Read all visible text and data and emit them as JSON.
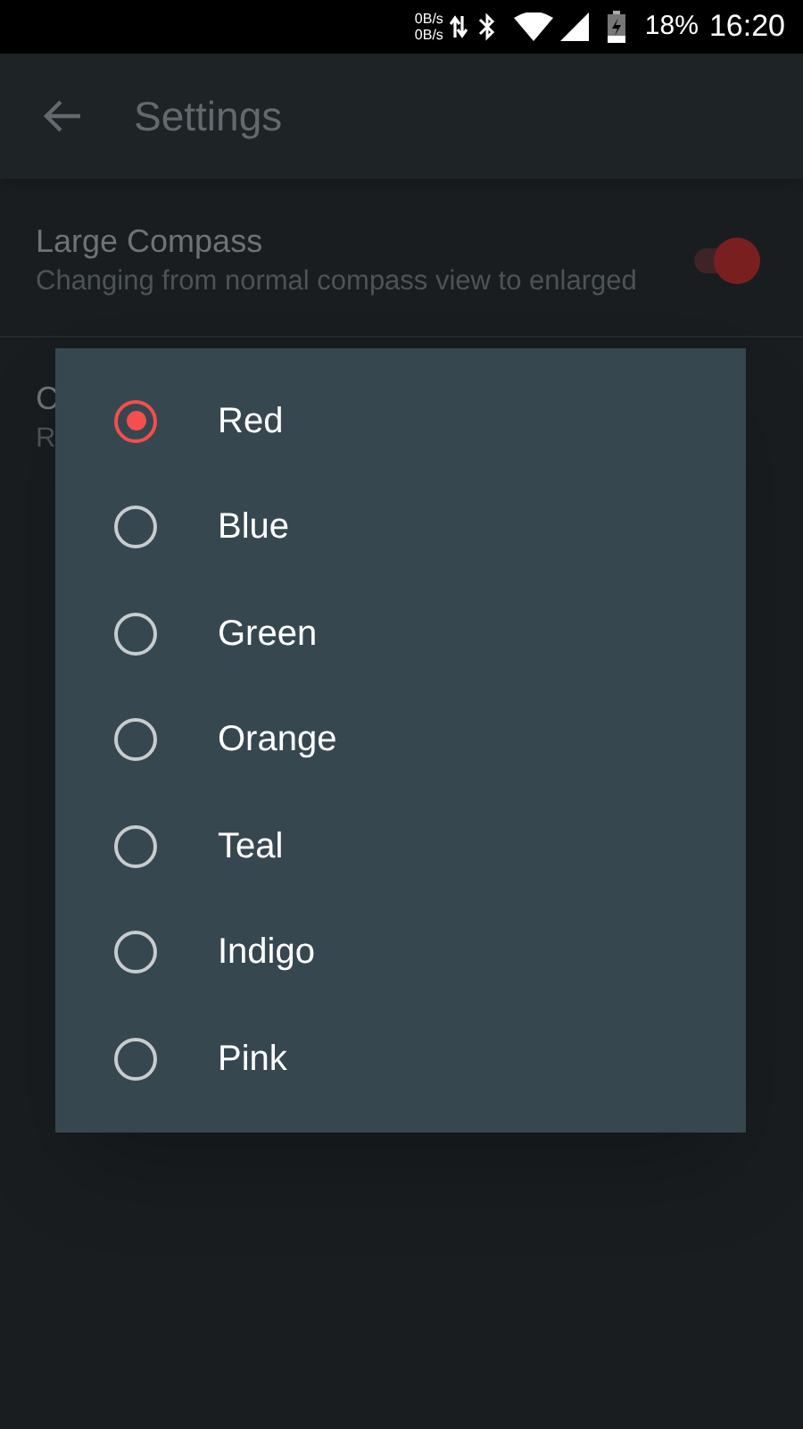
{
  "status_bar": {
    "net_up": "0B/s",
    "net_down": "0B/s",
    "battery": "18%",
    "time": "16:20"
  },
  "app_bar": {
    "title": "Settings"
  },
  "settings": [
    {
      "title": "Large Compass",
      "summary": "Changing from normal compass view to enlarged",
      "on": true
    },
    {
      "title": "C",
      "summary": "R"
    }
  ],
  "dialog": {
    "options": [
      {
        "label": "Red",
        "selected": true
      },
      {
        "label": "Blue",
        "selected": false
      },
      {
        "label": "Green",
        "selected": false
      },
      {
        "label": "Orange",
        "selected": false
      },
      {
        "label": "Teal",
        "selected": false
      },
      {
        "label": "Indigo",
        "selected": false
      },
      {
        "label": "Pink",
        "selected": false
      }
    ]
  }
}
